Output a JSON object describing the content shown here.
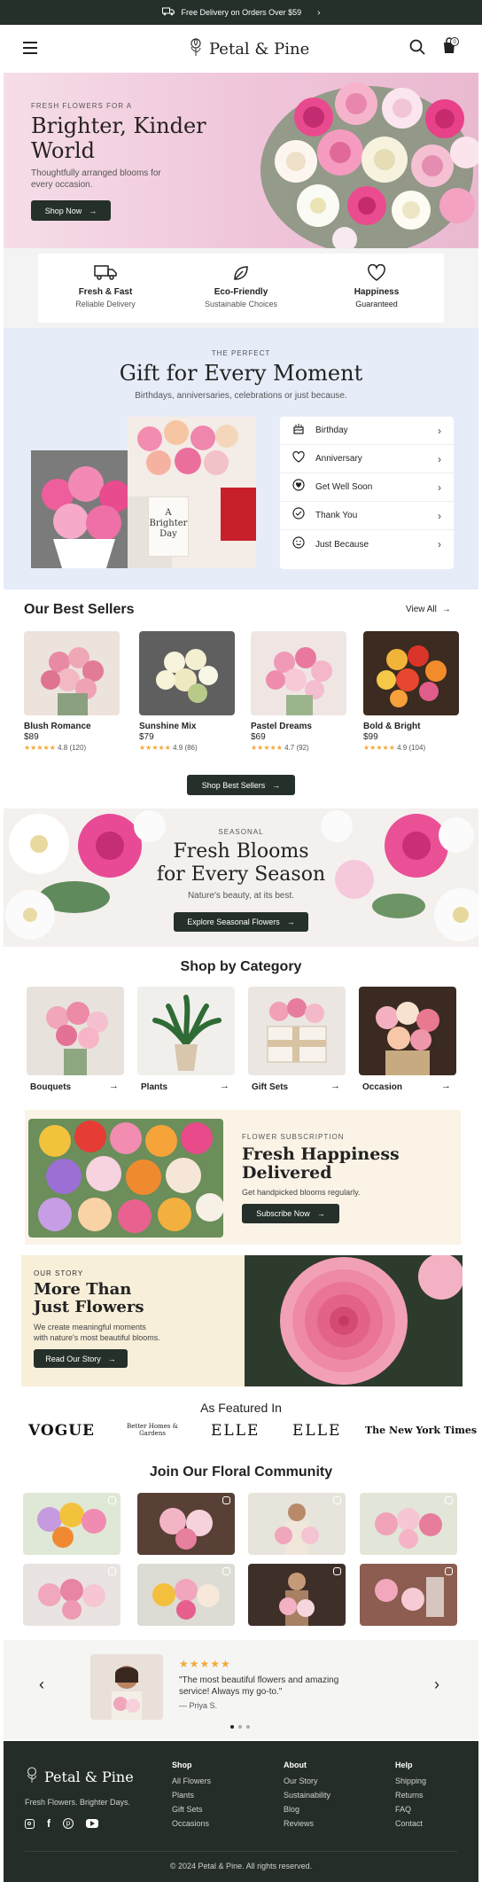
{
  "promo_bar": {
    "text": "Free Delivery on Orders Over $59",
    "icon": "truck-icon"
  },
  "header": {
    "brand": "Petal & Pine"
  },
  "hero": {
    "eyebrow": "FRESH FLOWERS FOR A",
    "title_line1": "Brighter, Kinder",
    "title_line2": "World",
    "subtitle_line1": "Thoughtfully arranged blooms for",
    "subtitle_line2": "every occasion.",
    "cta": "Shop Now"
  },
  "features": [
    {
      "title": "Fresh & Fast",
      "subtitle": "Reliable Delivery",
      "icon": "truck-icon"
    },
    {
      "title": "Eco-Friendly",
      "subtitle": "Sustainable Choices",
      "icon": "leaf-icon"
    },
    {
      "title": "Happiness",
      "subtitle": "Guaranteed",
      "icon": "heart-icon"
    }
  ],
  "gift": {
    "eyebrow": "THE PERFECT",
    "title": "Gift for Every Moment",
    "subtitle": "Birthdays, anniversaries, celebrations or just because.",
    "card_text": [
      "A",
      "Brighter",
      "Day"
    ],
    "occasions": [
      {
        "label": "Birthday",
        "icon": "cake-icon"
      },
      {
        "label": "Anniversary",
        "icon": "heart-icon"
      },
      {
        "label": "Get Well Soon",
        "icon": "heart-hand-icon"
      },
      {
        "label": "Thank You",
        "icon": "check-badge-icon"
      },
      {
        "label": "Just Because",
        "icon": "smile-icon"
      }
    ]
  },
  "best_sellers": {
    "title": "Our Best Sellers",
    "view_all": "View All",
    "cta": "Shop Best Sellers",
    "products": [
      {
        "name": "Blush Romance",
        "price": "$89",
        "rating": "4.8 (120)"
      },
      {
        "name": "Sunshine Mix",
        "price": "$79",
        "rating": "4.9 (86)"
      },
      {
        "name": "Pastel Dreams",
        "price": "$69",
        "rating": "4.7 (92)"
      },
      {
        "name": "Bold & Bright",
        "price": "$99",
        "rating": "4.9 (104)"
      }
    ]
  },
  "seasonal": {
    "eyebrow": "SEASONAL",
    "title_line1": "Fresh Blooms",
    "title_line2": "for Every Season",
    "subtitle": "Nature's beauty, at its best.",
    "cta": "Explore Seasonal Flowers"
  },
  "categories": {
    "title": "Shop by Category",
    "items": [
      {
        "label": "Bouquets"
      },
      {
        "label": "Plants"
      },
      {
        "label": "Gift Sets"
      },
      {
        "label": "Occasion"
      }
    ]
  },
  "subscription": {
    "eyebrow": "FLOWER SUBSCRIPTION",
    "title_line1": "Fresh Happiness",
    "title_line2": "Delivered",
    "subtitle": "Get handpicked blooms regularly.",
    "cta": "Subscribe Now"
  },
  "story": {
    "eyebrow": "OUR STORY",
    "title_line1": "More Than",
    "title_line2": "Just Flowers",
    "body_line1": "We create meaningful moments",
    "body_line2": "with nature's most beautiful blooms.",
    "cta": "Read Our Story"
  },
  "featured": {
    "title": "As Featured In",
    "logos": [
      "VOGUE",
      "Better Homes & Gardens",
      "ELLE",
      "ELLE",
      "The New York Times"
    ]
  },
  "community": {
    "title": "Join Our Floral Community"
  },
  "testimonial": {
    "stars": "★★★★★",
    "quote_line1": "\"The most beautiful flowers and amazing",
    "quote_line2": "service! Always my go-to.\"",
    "author": "— Priya S."
  },
  "footer": {
    "brand": "Petal & Pine",
    "tagline": "Fresh Flowers. Brighter Days.",
    "columns": [
      {
        "title": "Shop",
        "links": [
          "All Flowers",
          "Plants",
          "Gift Sets",
          "Occasions"
        ]
      },
      {
        "title": "About",
        "links": [
          "Our Story",
          "Sustainability",
          "Blog",
          "Reviews"
        ]
      },
      {
        "title": "Help",
        "links": [
          "Shipping",
          "Returns",
          "FAQ",
          "Contact"
        ]
      }
    ],
    "copyright": "© 2024 Petal & Pine. All rights reserved."
  },
  "colors": {
    "dark_green": "#25302a",
    "hero_pink": "#f1cfe0",
    "lavender": "#e6ebf9",
    "cream": "#faf3e6",
    "star": "#f2a93b"
  }
}
